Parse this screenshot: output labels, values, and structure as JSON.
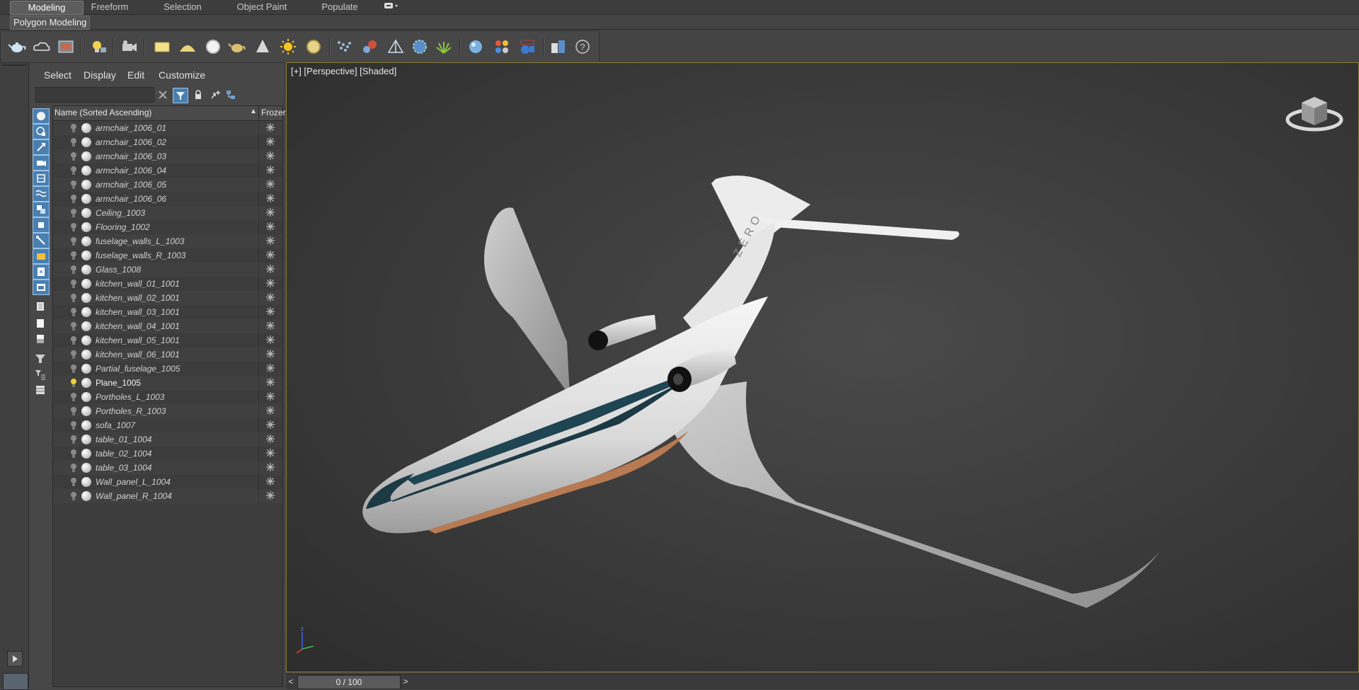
{
  "ribbon": {
    "tabs": [
      "Modeling",
      "Freeform",
      "Selection",
      "Object Paint",
      "Populate"
    ],
    "active_tab": "Modeling",
    "sub_label": "Polygon Modeling"
  },
  "toolbar": {
    "icons": [
      "teapot-icon",
      "cloud-icon",
      "image-icon",
      "light-bulb-icon",
      "camera-icon",
      "box-icon",
      "dome-icon",
      "sphere-icon",
      "teapot-primitive-icon",
      "cone-icon",
      "sun-icon",
      "sphere-light-icon",
      "particles-icon",
      "molecule-icon",
      "pyramid-icon",
      "gear-sphere-icon",
      "grass-icon",
      "material-sphere-icon",
      "color-swatches-icon",
      "render-icon",
      "layers-icon",
      "help-icon"
    ]
  },
  "explorer": {
    "menu": [
      "Select",
      "Display",
      "Edit",
      "Customize"
    ],
    "search_value": "",
    "columns": {
      "name": "Name (Sorted Ascending)",
      "frozen": "Frozen"
    },
    "rows": [
      {
        "name": "armchair_1006_01",
        "italic": true
      },
      {
        "name": "armchair_1006_02",
        "italic": true
      },
      {
        "name": "armchair_1006_03",
        "italic": true
      },
      {
        "name": "armchair_1006_04",
        "italic": true
      },
      {
        "name": "armchair_1006_05",
        "italic": true
      },
      {
        "name": "armchair_1006_06",
        "italic": true
      },
      {
        "name": "Ceiling_1003",
        "italic": true
      },
      {
        "name": "Flooring_1002",
        "italic": true
      },
      {
        "name": "fuselage_walls_L_1003",
        "italic": true
      },
      {
        "name": "fuselage_walls_R_1003",
        "italic": true
      },
      {
        "name": "Glass_1008",
        "italic": true
      },
      {
        "name": "kitchen_wall_01_1001",
        "italic": true
      },
      {
        "name": "kitchen_wall_02_1001",
        "italic": true
      },
      {
        "name": "kitchen_wall_03_1001",
        "italic": true
      },
      {
        "name": "kitchen_wall_04_1001",
        "italic": true
      },
      {
        "name": "kitchen_wall_05_1001",
        "italic": true
      },
      {
        "name": "kitchen_wall_06_1001",
        "italic": true
      },
      {
        "name": "Partial_fuselage_1005",
        "italic": true
      },
      {
        "name": "Plane_1005",
        "italic": false,
        "lit": true
      },
      {
        "name": "Portholes_L_1003",
        "italic": true
      },
      {
        "name": "Portholes_R_1003",
        "italic": true
      },
      {
        "name": "sofa_1007",
        "italic": true
      },
      {
        "name": "table_01_1004",
        "italic": true
      },
      {
        "name": "table_02_1004",
        "italic": true
      },
      {
        "name": "table_03_1004",
        "italic": true
      },
      {
        "name": "Wall_panel_L_1004",
        "italic": true
      },
      {
        "name": "Wall_panel_R_1004",
        "italic": true
      }
    ]
  },
  "viewport": {
    "label": "[+] [Perspective] [Shaded]",
    "tail_text": "ZERO",
    "colors": {
      "accent_border": "#8a7a30",
      "fuselage": "#e8e8e8",
      "cockpit_glass": "#1c3a44",
      "belly": "#b87a52"
    }
  },
  "timeline": {
    "frame_display": "0 / 100",
    "prev_arrow": "<",
    "next_arrow": ">"
  }
}
